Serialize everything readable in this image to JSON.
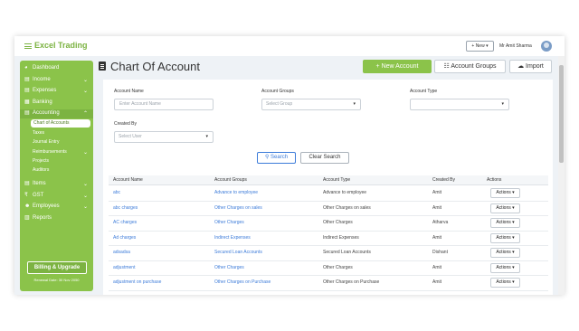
{
  "app": {
    "brand": "Excel Trading",
    "new_button": "+ New ▾",
    "user_name": "Mr Amit Sharma"
  },
  "sidebar": {
    "items": [
      {
        "label": "Dashboard",
        "icon": "dashboard-icon",
        "glyph": "◕",
        "chevron": ""
      },
      {
        "label": "Income",
        "icon": "income-icon",
        "glyph": "▤",
        "chevron": "⌄"
      },
      {
        "label": "Expenses",
        "icon": "expenses-icon",
        "glyph": "▤",
        "chevron": "⌄"
      },
      {
        "label": "Banking",
        "icon": "bank-icon",
        "glyph": "▦",
        "chevron": ""
      },
      {
        "label": "Accounting",
        "icon": "accounting-icon",
        "glyph": "▤",
        "chevron": "⌄"
      }
    ],
    "sub_items": [
      {
        "label": "Chart of Accounts"
      },
      {
        "label": "Taxes"
      },
      {
        "label": "Journal Entry"
      },
      {
        "label": "Reimbursements",
        "chevron": "⌄"
      },
      {
        "label": "Projects"
      },
      {
        "label": "Auditors"
      }
    ],
    "items2": [
      {
        "label": "Items",
        "icon": "items-icon",
        "glyph": "▤",
        "chevron": "⌄"
      },
      {
        "label": "GST",
        "icon": "rupee-icon",
        "glyph": "₹",
        "chevron": "⌄"
      },
      {
        "label": "Employees",
        "icon": "employees-icon",
        "glyph": "☻",
        "chevron": "⌄"
      },
      {
        "label": "Reports",
        "icon": "reports-icon",
        "glyph": "▥",
        "chevron": ""
      }
    ],
    "billing_label": "Billing & Upgrade",
    "renewal": "Renewal Date: 30 Nov 2050"
  },
  "page": {
    "title": "Chart Of Account",
    "new_account": "+ New Account",
    "account_groups": "☷ Account Groups",
    "import": "☁ Import"
  },
  "filters": {
    "account_name_label": "Account Name",
    "account_name_placeholder": "Enter Account Name",
    "account_groups_label": "Account Groups",
    "account_groups_value": "Select Group",
    "account_type_label": "Account Type",
    "account_type_value": "",
    "created_by_label": "Created By",
    "created_by_value": "Select User",
    "search_label": "⚲ Search",
    "clear_label": "Clear Search"
  },
  "table": {
    "headers": [
      "Account Name",
      "Account Groups",
      "Account Type",
      "Created By",
      "Actions"
    ],
    "rows": [
      {
        "name": "abc",
        "group": "Advance to employee",
        "type": "Advance to employee",
        "created_by": "Amit",
        "action": "Actions ▾"
      },
      {
        "name": "abc charges",
        "group": "Other Charges on sales",
        "type": "Other Charges on sales",
        "created_by": "Amit",
        "action": "Actions ▾"
      },
      {
        "name": "AC charges",
        "group": "Other Charges",
        "type": "Other Charges",
        "created_by": "Atharva",
        "action": "Actions ▾"
      },
      {
        "name": "Ad charges",
        "group": "Indirect Expenses",
        "type": "Indirect Expenses",
        "created_by": "Amit",
        "action": "Actions ▾"
      },
      {
        "name": "adsadsa",
        "group": "Secured Loan Accounts",
        "type": "Secured Loan Accounts",
        "created_by": "Dishant",
        "action": "Actions ▾"
      },
      {
        "name": "adjustment",
        "group": "Other Charges",
        "type": "Other Charges",
        "created_by": "Amit",
        "action": "Actions ▾"
      },
      {
        "name": "adjustment on purchase",
        "group": "Other Charges on Purchase",
        "type": "Other Charges on Purchase",
        "created_by": "Amit",
        "action": "Actions ▾"
      }
    ]
  },
  "colors": {
    "brand_green": "#8bc34a",
    "link_blue": "#3c7bd9"
  }
}
